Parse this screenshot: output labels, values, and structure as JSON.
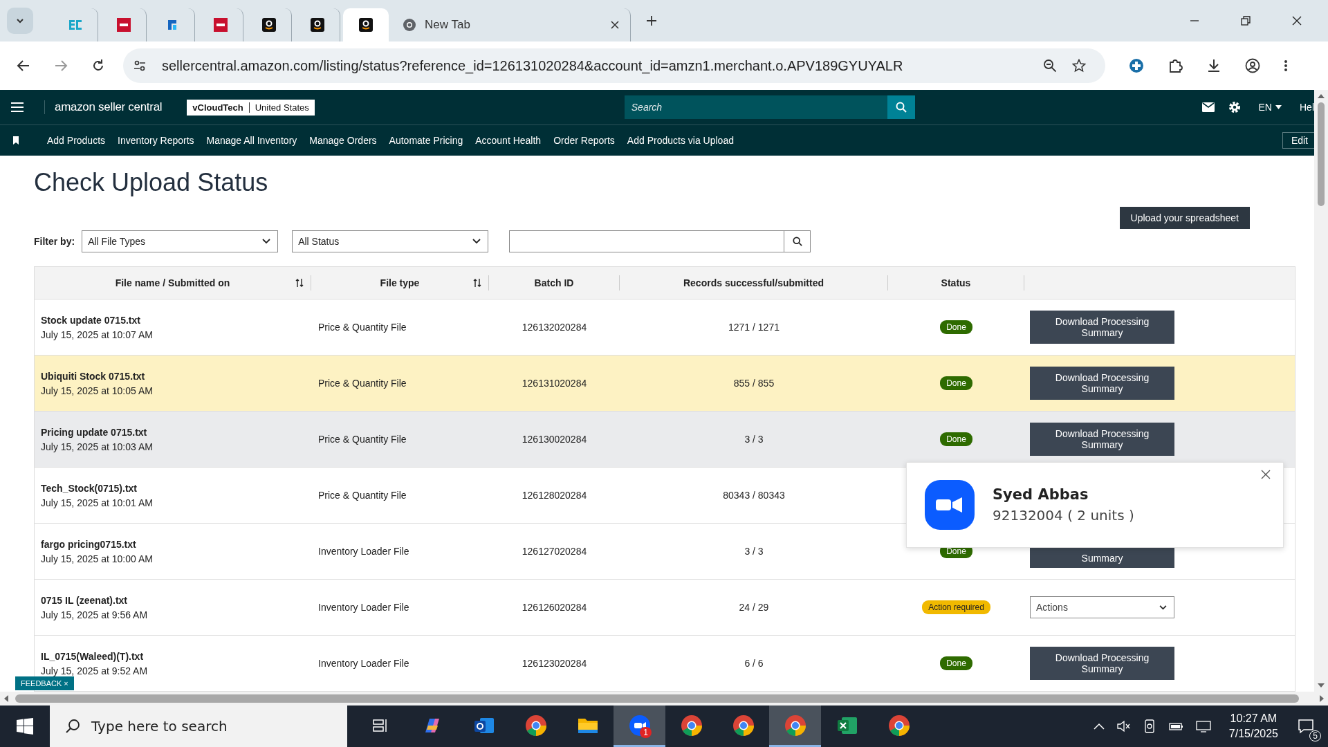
{
  "browser": {
    "tabs": [
      {
        "kind": "ec",
        "selected": false
      },
      {
        "kind": "dh",
        "selected": false
      },
      {
        "kind": "blue",
        "selected": false
      },
      {
        "kind": "dh",
        "selected": false
      },
      {
        "kind": "amazon",
        "selected": false
      },
      {
        "kind": "amazon",
        "selected": false
      },
      {
        "kind": "amazon",
        "selected": true
      },
      {
        "kind": "chrome",
        "label": "New Tab",
        "selected": false
      }
    ],
    "url": "sellercentral.amazon.com/listing/status?reference_id=126131020284&account_id=amzn1.merchant.o.APV189GYUYALR"
  },
  "header": {
    "logo": "amazon seller central",
    "store": "vCloudTech",
    "marketplace": "United States",
    "search_placeholder": "Search",
    "language": "EN",
    "help": "Hel"
  },
  "nav": {
    "items": [
      "Add Products",
      "Inventory Reports",
      "Manage All Inventory",
      "Manage Orders",
      "Automate Pricing",
      "Account Health",
      "Order Reports",
      "Add Products via Upload"
    ],
    "edit": "Edit"
  },
  "page": {
    "title": "Check Upload Status",
    "upload_button": "Upload your spreadsheet",
    "filter_label": "Filter by:",
    "filters": [
      "All File Types",
      "All Status"
    ]
  },
  "table": {
    "columns": [
      {
        "label": "File name / Submitted on",
        "sortable": true
      },
      {
        "label": "File type",
        "sortable": true
      },
      {
        "label": "Batch ID",
        "sortable": false
      },
      {
        "label": "Records successful/submitted",
        "sortable": false
      },
      {
        "label": "Status",
        "sortable": false
      }
    ],
    "rows": [
      {
        "name": "Stock update 0715.txt",
        "date": "July 15, 2025 at 10:07 AM",
        "type": "Price & Quantity File",
        "batch": "126132020284",
        "records": "1271 / 1271",
        "status": {
          "kind": "done",
          "label": "Done"
        },
        "action": {
          "kind": "button",
          "label": "Download Processing Summary"
        },
        "selected": false,
        "hovered": false
      },
      {
        "name": "Ubiquiti Stock 0715.txt",
        "date": "July 15, 2025 at 10:05 AM",
        "type": "Price & Quantity File",
        "batch": "126131020284",
        "records": "855 / 855",
        "status": {
          "kind": "done",
          "label": "Done"
        },
        "action": {
          "kind": "button",
          "label": "Download Processing Summary"
        },
        "selected": true,
        "hovered": false
      },
      {
        "name": "Pricing update 0715.txt",
        "date": "July 15, 2025 at 10:03 AM",
        "type": "Price & Quantity File",
        "batch": "126130020284",
        "records": "3 / 3",
        "status": {
          "kind": "done",
          "label": "Done"
        },
        "action": {
          "kind": "button",
          "label": "Download Processing Summary"
        },
        "selected": false,
        "hovered": true
      },
      {
        "name": "Tech_Stock(0715).txt",
        "date": "July 15, 2025 at 10:01 AM",
        "type": "Price & Quantity File",
        "batch": "126128020284",
        "records": "80343 / 80343",
        "selected": false,
        "hovered": false
      },
      {
        "name": "fargo pricing0715.txt",
        "date": "July 15, 2025 at 10:00 AM",
        "type": "Inventory Loader File",
        "batch": "126127020284",
        "records": "3 / 3",
        "status": {
          "kind": "done",
          "label": "Done"
        },
        "action": {
          "kind": "covered",
          "label": "Summary"
        },
        "selected": false,
        "hovered": false
      },
      {
        "name": "0715 IL (zeenat).txt",
        "date": "July 15, 2025 at 9:56 AM",
        "type": "Inventory Loader File",
        "batch": "126126020284",
        "records": "24 / 29",
        "status": {
          "kind": "action",
          "label": "Action required"
        },
        "action": {
          "kind": "dropdown",
          "label": "Actions"
        },
        "selected": false,
        "hovered": false
      },
      {
        "name": "IL_0715(Waleed)(T).txt",
        "date": "July 15, 2025 at 9:52 AM",
        "type": "Inventory Loader File",
        "batch": "126123020284",
        "records": "6 / 6",
        "status": {
          "kind": "done",
          "label": "Done"
        },
        "action": {
          "kind": "button",
          "label": "Download Processing Summary"
        },
        "selected": false,
        "hovered": false
      }
    ]
  },
  "notification": {
    "title": "Syed Abbas",
    "body": "92132004 ( 2 units )"
  },
  "feedback": {
    "label": "FEEDBACK",
    "close": "×"
  },
  "taskbar": {
    "search_placeholder": "Type here to search",
    "apps": [
      {
        "kind": "taskview",
        "active": false
      },
      {
        "kind": "copilot",
        "active": false
      },
      {
        "kind": "outlook",
        "active": false
      },
      {
        "kind": "chrome",
        "active": false
      },
      {
        "kind": "folder",
        "active": false
      },
      {
        "kind": "zoom",
        "active": true,
        "badge": "1"
      },
      {
        "kind": "chrome",
        "active": false
      },
      {
        "kind": "chrome",
        "active": false
      },
      {
        "kind": "chrome",
        "active": true
      },
      {
        "kind": "excel",
        "active": false
      },
      {
        "kind": "chrome",
        "active": false
      }
    ],
    "time": "10:27 AM",
    "date": "7/15/2025",
    "notifications": "5"
  }
}
